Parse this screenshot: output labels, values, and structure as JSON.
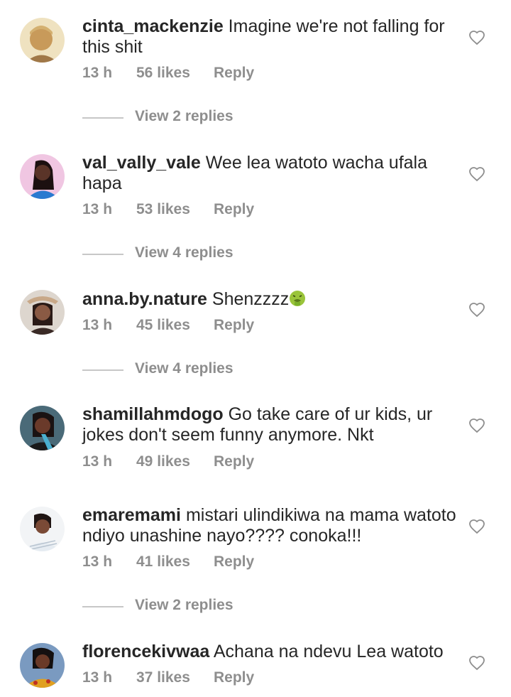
{
  "comments": [
    {
      "username": "cinta_mackenzie",
      "text": "Imagine we're not falling for this shit",
      "time": "13 h",
      "likes": "56 likes",
      "reply": "Reply",
      "view_replies": "View 2 replies",
      "avatar_colors": {
        "bg": "#e8d6a8",
        "skin": "#c89a5a",
        "hair": "#d4b070"
      }
    },
    {
      "username": "val_vally_vale",
      "text": "Wee lea watoto wacha ufala hapa",
      "time": "13 h",
      "likes": "53 likes",
      "reply": "Reply",
      "view_replies": "View 4 replies",
      "avatar_colors": {
        "bg": "#e8b6d8",
        "skin": "#5a3428",
        "hair": "#1c1010"
      }
    },
    {
      "username": "anna.by.nature",
      "text": "Shenzzzz",
      "emoji": "nauseated-face",
      "time": "13 h",
      "likes": "45 likes",
      "reply": "Reply",
      "view_replies": "View 4 replies",
      "avatar_colors": {
        "bg": "#d9d2ca",
        "skin": "#8a5a44",
        "hair": "#2a1a16"
      }
    },
    {
      "username": "shamillahmdogo",
      "text": "Go take care of ur kids, ur jokes don't seem funny anymore. Nkt",
      "time": "13 h",
      "likes": "49 likes",
      "reply": "Reply",
      "view_replies": "",
      "avatar_colors": {
        "bg": "#4a6a78",
        "skin": "#6a3a2a",
        "hair": "#1a1212"
      }
    },
    {
      "username": "emaremami",
      "text": "mistari ulindikiwa na mama watoto ndiyo unashine nayo???? conoka!!!",
      "time": "13 h",
      "likes": "41 likes",
      "reply": "Reply",
      "view_replies": "View 2 replies",
      "avatar_colors": {
        "bg": "#eef0f2",
        "skin": "#7a4a36",
        "hair": "#201614"
      }
    },
    {
      "username": "florencekivwaa",
      "text": "Achana na ndevu Lea watoto",
      "time": "13 h",
      "likes": "37 likes",
      "reply": "Reply",
      "view_replies": "",
      "avatar_colors": {
        "bg": "#6a8ab0",
        "skin": "#6a3a28",
        "hair": "#141010"
      }
    }
  ],
  "colors": {
    "text": "#262626",
    "secondary": "#8e8e8e",
    "line": "#c7c7c7"
  },
  "icons": {
    "like": "heart-outline-icon"
  }
}
